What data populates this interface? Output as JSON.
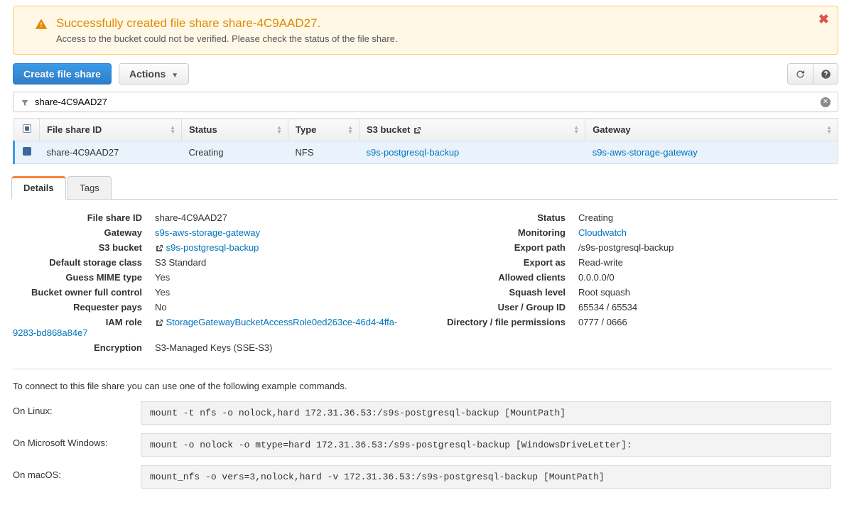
{
  "alert": {
    "title": "Successfully created file share share-4C9AAD27.",
    "text": "Access to the bucket could not be verified. Please check the status of the file share."
  },
  "toolbar": {
    "create_label": "Create file share",
    "actions_label": "Actions"
  },
  "filter": {
    "value": "share-4C9AAD27"
  },
  "columns": {
    "file_share_id": "File share ID",
    "status": "Status",
    "type": "Type",
    "s3_bucket": "S3 bucket",
    "gateway": "Gateway"
  },
  "row": {
    "id": "share-4C9AAD27",
    "status": "Creating",
    "type": "NFS",
    "bucket": "s9s-postgresql-backup",
    "gateway": "s9s-aws-storage-gateway"
  },
  "tabs": {
    "details": "Details",
    "tags": "Tags"
  },
  "details": {
    "left_labels": {
      "file_share_id": "File share ID",
      "gateway": "Gateway",
      "s3_bucket": "S3 bucket",
      "default_storage_class": "Default storage class",
      "guess_mime": "Guess MIME type",
      "bucket_owner": "Bucket owner full control",
      "requester_pays": "Requester pays",
      "iam_role": "IAM role",
      "encryption": "Encryption"
    },
    "left_values": {
      "file_share_id": "share-4C9AAD27",
      "gateway": "s9s-aws-storage-gateway",
      "s3_bucket": "s9s-postgresql-backup",
      "default_storage_class": "S3 Standard",
      "guess_mime": "Yes",
      "bucket_owner": "Yes",
      "requester_pays": "No",
      "iam_role": "StorageGatewayBucketAccessRole0ed263ce-46d4-4ffa-9283-bd868a84e7",
      "encryption": "S3-Managed Keys (SSE-S3)"
    },
    "right_labels": {
      "status": "Status",
      "monitoring": "Monitoring",
      "export_path": "Export path",
      "export_as": "Export as",
      "allowed_clients": "Allowed clients",
      "squash_level": "Squash level",
      "user_group_id": "User / Group ID",
      "dir_file_perm": "Directory / file permissions"
    },
    "right_values": {
      "status": "Creating",
      "monitoring": "Cloudwatch",
      "export_path": "/s9s-postgresql-backup",
      "export_as": "Read-write",
      "allowed_clients": "0.0.0.0/0",
      "squash_level": "Root squash",
      "user_group_id": "65534 / 65534",
      "dir_file_perm": "0777 / 0666"
    }
  },
  "connect": {
    "intro": "To connect to this file share you can use one of the following example commands.",
    "linux_label": "On Linux:",
    "windows_label": "On Microsoft Windows:",
    "macos_label": "On macOS:",
    "linux_cmd": "mount -t nfs -o nolock,hard 172.31.36.53:/s9s-postgresql-backup [MountPath]",
    "windows_cmd": "mount -o nolock -o mtype=hard 172.31.36.53:/s9s-postgresql-backup [WindowsDriveLetter]:",
    "macos_cmd": "mount_nfs -o vers=3,nolock,hard -v 172.31.36.53:/s9s-postgresql-backup [MountPath]"
  }
}
